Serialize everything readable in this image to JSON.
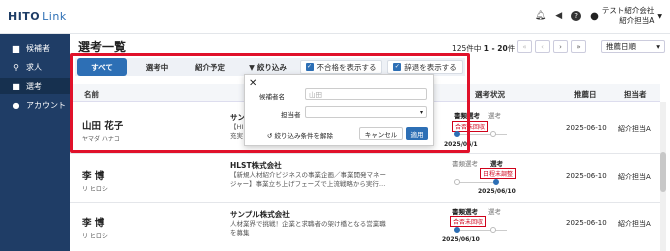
{
  "app": {
    "logo_hito": "HITO",
    "logo_link": "Link"
  },
  "sidebar": {
    "items": [
      {
        "label": "候補者",
        "icon": "id-card-icon"
      },
      {
        "label": "求人",
        "icon": "search-icon"
      },
      {
        "label": "選考",
        "icon": "briefcase-icon",
        "active": true
      },
      {
        "label": "アカウント",
        "icon": "user-icon"
      }
    ]
  },
  "header": {
    "company": "テスト紹介会社",
    "user": "紹介担当A",
    "help": "?"
  },
  "page": {
    "title": "選考一覧",
    "count_prefix": "125件中",
    "count_range": "1 - 20",
    "count_suffix": "件",
    "sort": "推薦日順"
  },
  "pager": {
    "first": "«",
    "prev": "‹",
    "next": "›",
    "last": "»"
  },
  "tabs": {
    "all": "すべて",
    "in_progress": "選考中",
    "scheduled": "紹介予定",
    "filter": "絞り込み",
    "show_rejected": "不合格を表示する",
    "show_declined": "辞退を表示する"
  },
  "table": {
    "headers": {
      "name": "名前",
      "status": "選考状況",
      "recommended": "推薦日",
      "owner": "担当者"
    },
    "rows": [
      {
        "name": "山田 花子",
        "kana": "ヤマダ ハナコ",
        "company": "サン",
        "desc1": "【HI",
        "desc2": "充実",
        "stage_current": "書類選考",
        "stage_next": "選考",
        "badge": "合否未回収",
        "stage_date": "2025/06/1",
        "date": "2025-06-10",
        "owner": "紹介担当A"
      },
      {
        "name": "李 博",
        "kana": "リ ヒロシ",
        "company": "HLST株式会社",
        "desc1": "【新規人材紹介ビジネスの事業企画／事業開発マネー",
        "desc2": "ジャー】事業立ち上げフェーズで上流戦略から実行…",
        "stage_prev": "書類選考",
        "stage_current": "選考",
        "badge": "日程未調整",
        "stage_date": "2025/06/10",
        "date": "2025-06-10",
        "owner": "紹介担当A"
      },
      {
        "name": "李 博",
        "kana": "リ ヒロシ",
        "company": "サンプル株式会社",
        "desc1": "人材業界で挑戦！企業と求職者の架け橋となる営業職",
        "desc2": "を募集",
        "stage_current": "書類選考",
        "stage_next": "選考",
        "badge": "合否未回収",
        "stage_date": "2025/06/10",
        "date": "2025-06-10",
        "owner": "紹介担当A"
      }
    ]
  },
  "filter_popup": {
    "close": "✕",
    "candidate_label": "候補者名",
    "candidate_placeholder": "山田",
    "owner_label": "担当者",
    "clear": "絞り込み条件を解除",
    "cancel": "キャンセル",
    "apply": "適用"
  },
  "colors": {
    "sidebar_bg": "#1f3d66",
    "accent": "#2d6fb5",
    "alert": "#d0021b",
    "highlight_box": "#e0112a"
  }
}
